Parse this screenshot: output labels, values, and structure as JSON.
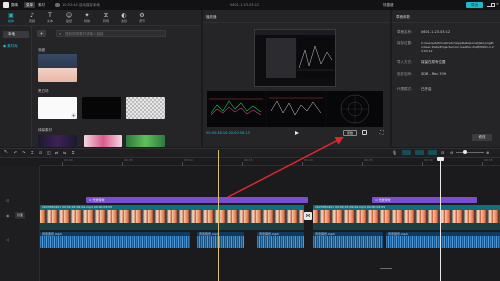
{
  "titlebar": {
    "app_name": "剪映",
    "menu_label": "菜单",
    "media_tag": "素材",
    "autosave": "10:53:44 自动保存本地",
    "document_title": "0601-1.23.03:12",
    "shortcut_label": "快捷键",
    "export_label": "导出",
    "accent_color": "#20b8c9"
  },
  "toolbar": {
    "items": [
      {
        "icon": "media-icon",
        "glyph": "▣",
        "label": "媒体"
      },
      {
        "icon": "audio-icon",
        "glyph": "♪",
        "label": "音频"
      },
      {
        "icon": "text-icon",
        "glyph": "T",
        "label": "文本"
      },
      {
        "icon": "sticker-icon",
        "glyph": "☺",
        "label": "贴纸"
      },
      {
        "icon": "effects-icon",
        "glyph": "✦",
        "label": "特效"
      },
      {
        "icon": "transition-icon",
        "glyph": "⧖",
        "label": "转场"
      },
      {
        "icon": "filter-icon",
        "glyph": "◐",
        "label": "滤镜"
      },
      {
        "icon": "adjust-icon",
        "glyph": "⚙",
        "label": "调节"
      }
    ]
  },
  "media_panel": {
    "sidebar": {
      "local": "本地",
      "library": "● 素材库"
    },
    "import_label": "+",
    "search_placeholder": "搜索视频素材或输入链接",
    "sections": {
      "favorites": "收藏",
      "transitions": "黑白场",
      "promo": "绿幕素材"
    }
  },
  "player": {
    "title": "播放器",
    "timecode": "00:00:38:16  00:00:56:15",
    "ratio_label": "原始"
  },
  "details": {
    "title": "草稿参数",
    "rows": [
      {
        "label": "草稿名称：",
        "value": "0601-1.23.03:12"
      },
      {
        "label": "保存位置：",
        "value": "C:/Users/Administrator/AppData/Local/JianyingPro/User Data/Projects/com.lveditor.draft/0601-1.23.03:12"
      },
      {
        "label": "导入方式：",
        "value": "保留在原有位置"
      },
      {
        "label": "色彩空间：",
        "value": "SDR - Rec.709"
      },
      {
        "label": "代理模式：",
        "value": "已开启"
      }
    ],
    "modify_label": "修改"
  },
  "timeline": {
    "ruler_labels": [
      "00:00",
      "00:05",
      "00:10",
      "00:15",
      "00:20",
      "00:25",
      "00:30",
      "00:35",
      "00:40"
    ],
    "cover_label": "封面",
    "fx_clips": [
      "⊙ 光斑特效",
      "⊙ 光斑特效"
    ],
    "video_clips": [
      "2023050201 00:00:01:09:09.mp4  00:00:03:05",
      "2023050201 00:00:01:09:09.mp4  00:00:03:05"
    ],
    "audio_clips": [
      "背景音乐.mp3",
      "背景音乐.mp3",
      "背景音乐.mp3",
      "背景音乐.mp3",
      "背景音乐.mp3"
    ]
  }
}
